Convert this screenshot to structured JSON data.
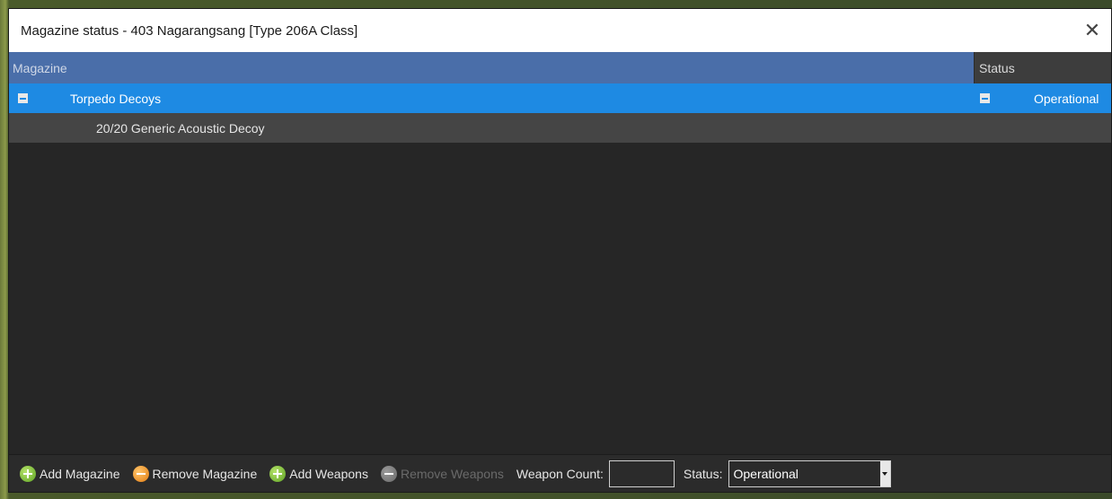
{
  "window": {
    "title": "Magazine status - 403 Nagarangsang [Type 206A Class]"
  },
  "columns": {
    "magazine": "Magazine",
    "status": "Status"
  },
  "rows": [
    {
      "label": "Torpedo Decoys",
      "status": "Operational",
      "selected": true
    },
    {
      "label": "20/20 Generic Acoustic Decoy",
      "status": ""
    }
  ],
  "toolbar": {
    "add_magazine": "Add Magazine",
    "remove_magazine": "Remove Magazine",
    "add_weapons": "Add Weapons",
    "remove_weapons": "Remove Weapons",
    "weapon_count_label": "Weapon Count:",
    "weapon_count_value": "",
    "status_label": "Status:",
    "status_value": "Operational"
  },
  "icons": {
    "close": "close-icon",
    "expander": "minus-box-icon",
    "add": "add-circle-icon",
    "remove": "remove-circle-icon",
    "dropdown": "chevron-down-icon"
  },
  "colors": {
    "header_bg": "#4a6ea9",
    "selected_row": "#1e8ae3",
    "child_row": "#454545",
    "grid_bg": "#262626",
    "add_icon": "#5ea322",
    "remove_icon": "#e27d12"
  }
}
